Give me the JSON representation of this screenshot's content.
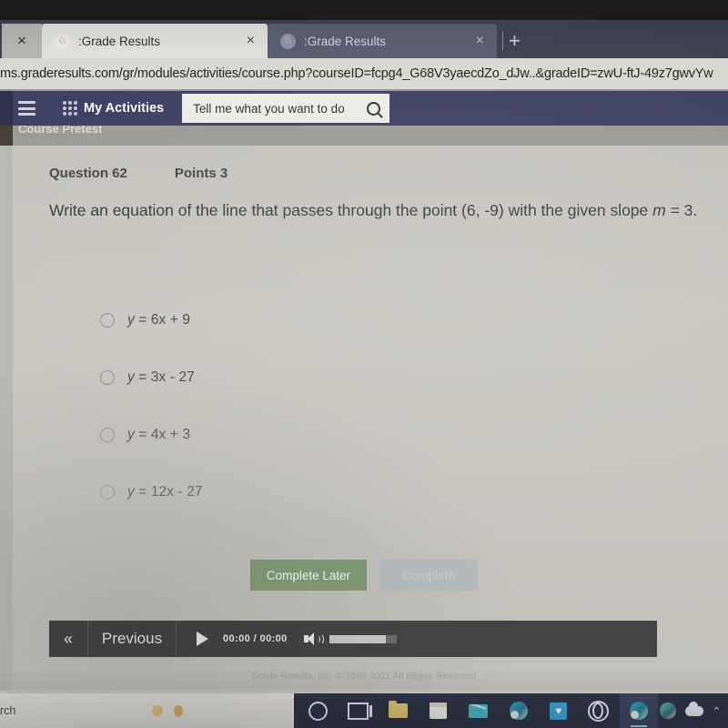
{
  "browser": {
    "tabs": [
      {
        "title": ":Grade Results",
        "favicon": "grade-results-favicon",
        "active": true,
        "close_label": "×"
      },
      {
        "title": ":Grade Results",
        "favicon": "grade-results-favicon",
        "active": false,
        "close_label": "×"
      }
    ],
    "left_close_label": "×",
    "new_tab_label": "+",
    "url": "ms.graderesults.com/gr/modules/activities/course.php?courseID=fcpg4_G68V3yaecdZo_dJw..&gradeID=zwU-ftJ-49z7gwvYw"
  },
  "appnav": {
    "menu_icon": "hamburger-icon",
    "activities_label": "My Activities",
    "search_placeholder": "Tell me what you want to do",
    "search_value": "Tell me what you want to do",
    "search_icon": "search-icon"
  },
  "breadcrumb": {
    "label": "Course Pretest"
  },
  "question": {
    "number_label": "Question 62",
    "points_label": "Points 3",
    "prompt_part1": "Write an equation of the line that passes through the point (6, -9) with the given slope ",
    "prompt_italic": "m",
    "prompt_part2": " = 3.",
    "options": [
      {
        "id": "option-a",
        "prefix_italic": "y",
        "text": " = 6x + 9",
        "selected": false
      },
      {
        "id": "option-b",
        "prefix_italic": "y",
        "text": " = 3x - 27",
        "selected": false
      },
      {
        "id": "option-c",
        "prefix_italic": "y",
        "text": " = 4x + 3",
        "selected": false
      },
      {
        "id": "option-d",
        "prefix_italic": "y",
        "text": " = 12x - 27",
        "selected": false
      }
    ]
  },
  "actions": {
    "complete_later_label": "Complete Later",
    "complete_label": "Complete",
    "complete_later_color": "#82a074",
    "complete_color": "#b9c0c2"
  },
  "player": {
    "collapse_label": "«",
    "previous_label": "Previous",
    "play_icon": "play-icon",
    "current_time": "00:00",
    "separator": "/",
    "total_time": "00:00",
    "volume_icon": "speaker-icon",
    "volume_level": 84
  },
  "footer": {
    "copyright": "Grade Results, Inc. © 2006-2021 All Rights Reserved"
  },
  "taskbar": {
    "search_text": "rch",
    "weather_temp": "",
    "weather_label": "",
    "icons": [
      {
        "name": "cortana-icon",
        "label": ""
      },
      {
        "name": "task-view-icon",
        "label": ""
      },
      {
        "name": "file-explorer-icon",
        "label": ""
      },
      {
        "name": "calendar-icon",
        "label": ""
      },
      {
        "name": "mail-icon",
        "label": ""
      },
      {
        "name": "edge-browser-icon",
        "label": ""
      },
      {
        "name": "microsoft-store-icon",
        "label": "♥"
      },
      {
        "name": "opera-browser-icon",
        "label": ""
      },
      {
        "name": "edge-browser-active-icon",
        "label": ""
      }
    ],
    "tray": [
      {
        "name": "globe-icon"
      },
      {
        "name": "cloud-icon"
      },
      {
        "name": "chevron-up-icon",
        "label": "⌃"
      }
    ]
  }
}
